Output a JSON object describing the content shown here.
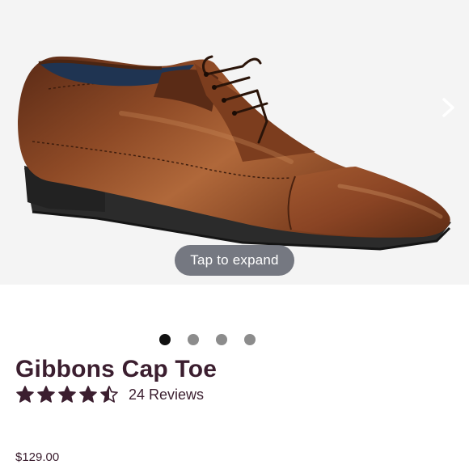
{
  "gallery": {
    "image": "brown-leather-cap-toe-oxford-shoe",
    "expand_label": "Tap to expand",
    "slide_count": 4,
    "active_slide": 1,
    "next_icon": "chevron-right-icon"
  },
  "product": {
    "name": "Gibbons Cap Toe",
    "rating": 4.5,
    "rating_max": 5,
    "reviews_label": "24 Reviews",
    "price": "$129.00"
  },
  "colors": {
    "brand_text": "#3b1e2f",
    "leather": "#8a4424",
    "sole": "#2b2b2b",
    "gallery_bg": "#f4f4f4"
  }
}
